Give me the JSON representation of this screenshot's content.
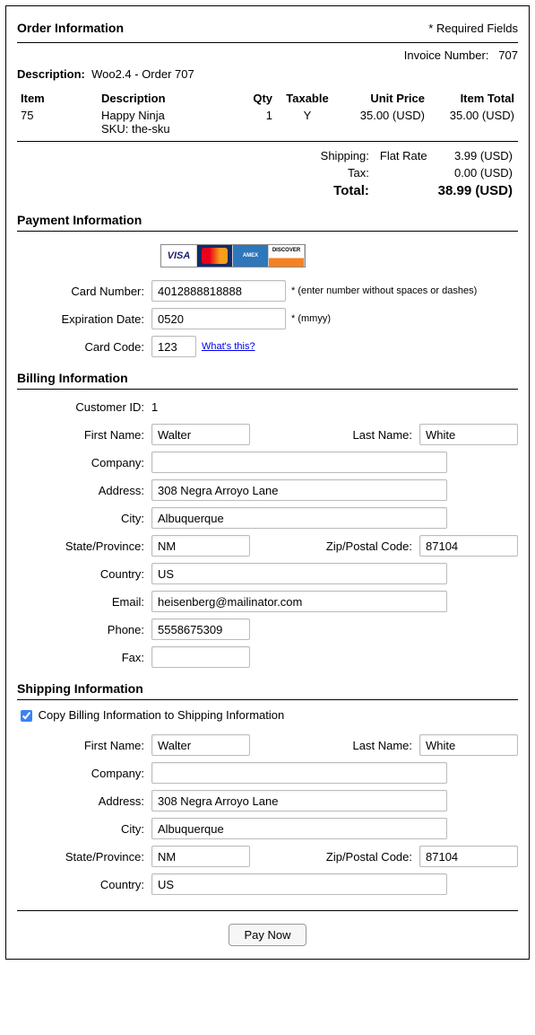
{
  "header": {
    "order_info": "Order Information",
    "required": "* Required Fields",
    "invoice_label": "Invoice Number:",
    "invoice_number": "707",
    "description_label": "Description:",
    "description_value": "Woo2.4 - Order 707"
  },
  "items_table": {
    "headers": {
      "item": "Item",
      "desc": "Description",
      "qty": "Qty",
      "taxable": "Taxable",
      "unit": "Unit Price",
      "total": "Item Total"
    },
    "rows": [
      {
        "item": "75",
        "desc": "Happy Ninja",
        "sku": "SKU: the-sku",
        "qty": "1",
        "taxable": "Y",
        "unit": "35.00 (USD)",
        "total": "35.00 (USD)"
      }
    ]
  },
  "totals": {
    "shipping_label": "Shipping:",
    "shipping_method": "Flat Rate",
    "shipping_value": "3.99 (USD)",
    "tax_label": "Tax:",
    "tax_value": "0.00 (USD)",
    "total_label": "Total:",
    "total_value": "38.99 (USD)"
  },
  "payment": {
    "heading": "Payment Information",
    "card_number_label": "Card Number:",
    "card_number": "4012888818888",
    "card_hint": "* (enter number without spaces or dashes)",
    "exp_label": "Expiration Date:",
    "exp": "0520",
    "exp_hint": "* (mmyy)",
    "code_label": "Card Code:",
    "code": "123",
    "code_link": "What's this?"
  },
  "billing": {
    "heading": "Billing Information",
    "customer_id_label": "Customer ID:",
    "customer_id": "1",
    "first_label": "First Name:",
    "first": "Walter",
    "last_label": "Last Name:",
    "last": "White",
    "company_label": "Company:",
    "company": "",
    "address_label": "Address:",
    "address": "308 Negra Arroyo Lane",
    "city_label": "City:",
    "city": "Albuquerque",
    "state_label": "State/Province:",
    "state": "NM",
    "zip_label": "Zip/Postal Code:",
    "zip": "87104",
    "country_label": "Country:",
    "country": "US",
    "email_label": "Email:",
    "email": "heisenberg@mailinator.com",
    "phone_label": "Phone:",
    "phone": "5558675309",
    "fax_label": "Fax:",
    "fax": ""
  },
  "shipping": {
    "heading": "Shipping Information",
    "copy_label": "Copy Billing Information to Shipping Information",
    "first_label": "First Name:",
    "first": "Walter",
    "last_label": "Last Name:",
    "last": "White",
    "company_label": "Company:",
    "company": "",
    "address_label": "Address:",
    "address": "308 Negra Arroyo Lane",
    "city_label": "City:",
    "city": "Albuquerque",
    "state_label": "State/Province:",
    "state": "NM",
    "zip_label": "Zip/Postal Code:",
    "zip": "87104",
    "country_label": "Country:",
    "country": "US"
  },
  "pay_button": "Pay Now"
}
